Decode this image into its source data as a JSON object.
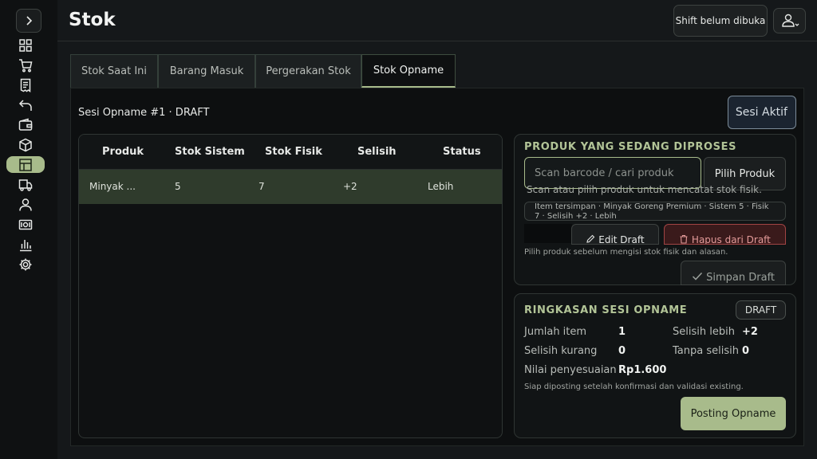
{
  "header": {
    "title": "Stok",
    "shift_label": "Shift belum dibuka"
  },
  "sidebar": {
    "items": [
      {
        "icon": "dashboard-icon"
      },
      {
        "icon": "cart-icon"
      },
      {
        "icon": "receipt-icon"
      },
      {
        "icon": "undo-icon"
      },
      {
        "icon": "wallet-icon"
      },
      {
        "icon": "box-icon"
      },
      {
        "icon": "table-icon",
        "active": true
      },
      {
        "icon": "truck-icon"
      },
      {
        "icon": "person-icon"
      },
      {
        "icon": "cash-icon"
      },
      {
        "icon": "bar-chart-icon"
      },
      {
        "icon": "gear-icon"
      }
    ],
    "accent": "#a8bb8b"
  },
  "tabs": [
    {
      "label": "Stok Saat Ini"
    },
    {
      "label": "Barang Masuk"
    },
    {
      "label": "Pergerakan Stok"
    },
    {
      "label": "Stok Opname"
    }
  ],
  "session": {
    "title": "Sesi Opname #1 · DRAFT",
    "active_button": "Sesi Aktif"
  },
  "table": {
    "columns": [
      "Produk",
      "Stok Sistem",
      "Stok Fisik",
      "Selisih",
      "Status"
    ],
    "rows": [
      [
        "Minyak ...",
        "5",
        "7",
        "+2",
        "Lebih"
      ]
    ]
  },
  "processing": {
    "title": "PRODUK YANG SEDANG DIPROSES",
    "search_placeholder": "Scan barcode / cari produk",
    "pick_button": "Pilih Produk",
    "helper": "Scan atau pilih produk untuk mencatat stok fisik.",
    "saved_line1": "Item tersimpan · Minyak Goreng Premium · Sistem 5 · Fisik",
    "saved_line2": "7 · Selisih +2 · Lebih",
    "edit_button": "Edit Draft",
    "delete_button": "Hapus dari Draft",
    "hint": "Pilih produk sebelum mengisi stok fisik dan alasan.",
    "save_button": "Simpan Draft"
  },
  "summary": {
    "title": "RINGKASAN SESI OPNAME",
    "badge": "DRAFT",
    "jumlah_item_label": "Jumlah item",
    "jumlah_item_value": "1",
    "selisih_lebih_label": "Selisih lebih",
    "selisih_lebih_value": "+2",
    "selisih_kurang_label": "Selisih kurang",
    "selisih_kurang_value": "0",
    "tanpa_selisih_label": "Tanpa selisih",
    "tanpa_selisih_value": "0",
    "nilai_label": "Nilai penyesuaian",
    "nilai_value": "Rp1.600",
    "note": "Siap diposting setelah konfirmasi dan validasi existing.",
    "posting_button": "Posting Opname"
  }
}
